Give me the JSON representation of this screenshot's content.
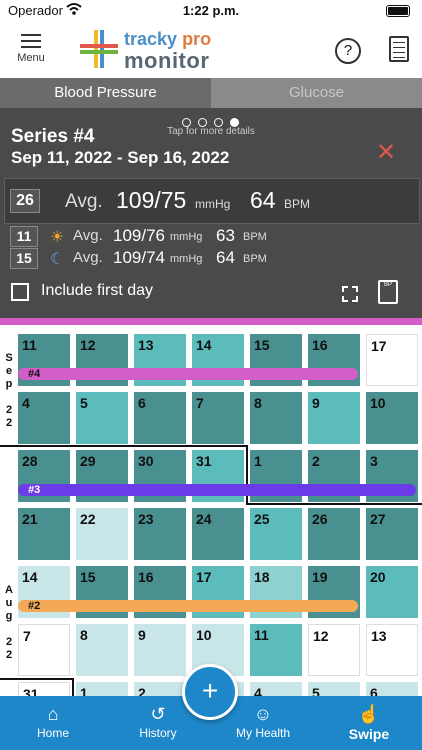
{
  "status": {
    "carrier": "Operador",
    "time": "1:22 p.m."
  },
  "appbar": {
    "menu_label": "Menu",
    "brand_top": "tracky",
    "brand_pro": "pro",
    "brand_bottom": "monitor",
    "help": "?"
  },
  "tabs": {
    "blood_pressure": "Blood Pressure",
    "glucose": "Glucose"
  },
  "panel": {
    "tap_hint": "Tap for more details",
    "series_title": "Series #4",
    "series_dates": "Sep 11, 2022 - Sep 16, 2022",
    "overall": {
      "count": "26",
      "avg_label": "Avg.",
      "bp": "109/75",
      "bp_unit": "mmHg",
      "hr": "64",
      "hr_unit": "BPM"
    },
    "day": {
      "count": "11",
      "avg_label": "Avg.",
      "bp": "109/76",
      "bp_unit": "mmHg",
      "hr": "63",
      "hr_unit": "BPM"
    },
    "night": {
      "count": "15",
      "avg_label": "Avg.",
      "bp": "109/74",
      "bp_unit": "mmHg",
      "hr": "64",
      "hr_unit": "BPM"
    },
    "include_first_day": "Include first day",
    "report_icon_text": "BP"
  },
  "calendar": {
    "month_sep": [
      "S",
      "e",
      "p",
      "",
      "2",
      "2"
    ],
    "month_aug": [
      "A",
      "u",
      "g",
      "",
      "2",
      "2"
    ],
    "rows": [
      [
        "11",
        "12",
        "13",
        "14",
        "15",
        "16",
        "17"
      ],
      [
        "4",
        "5",
        "6",
        "7",
        "8",
        "9",
        "10"
      ],
      [
        "28",
        "29",
        "30",
        "31",
        "1",
        "2",
        "3"
      ],
      [
        "21",
        "22",
        "23",
        "24",
        "25",
        "26",
        "27"
      ],
      [
        "14",
        "15",
        "16",
        "17",
        "18",
        "19",
        "20"
      ],
      [
        "7",
        "8",
        "9",
        "10",
        "11",
        "12",
        "13"
      ],
      [
        "31",
        "1",
        "2",
        "3",
        "4",
        "5",
        "6"
      ]
    ],
    "series_labels": [
      "#4",
      "#3",
      "#2"
    ]
  },
  "nav": {
    "home": "Home",
    "history": "History",
    "my_health": "My Health",
    "swipe": "Swipe",
    "fab": "+"
  }
}
